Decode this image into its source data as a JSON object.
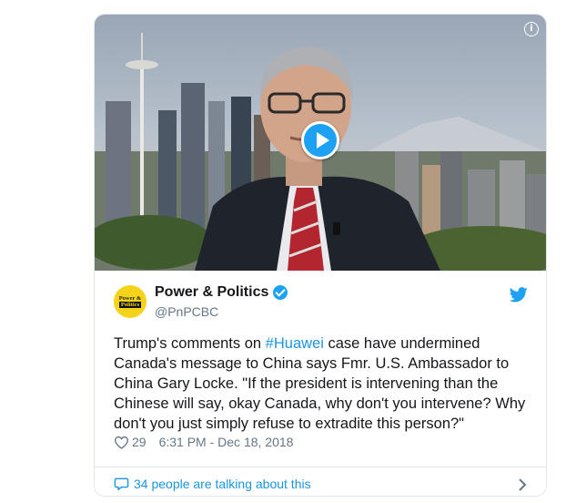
{
  "tweet": {
    "author_name": "Power & Politics",
    "handle": "@PnPCBC",
    "avatar_text": [
      "Power &",
      "Politics"
    ],
    "text_before": "Trump's comments on ",
    "hashtag": "#Huawei",
    "text_after": " case have undermined Canada's message to China says Fmr. U.S. Ambassador to China Gary Locke. \"If the president is intervening than the Chinese will say, okay Canada, why don't you intervene? Why don't you just simply refuse to extradite this person?\"",
    "likes": "29",
    "timestamp": "6:31 PM - Dec 18, 2018",
    "talking": "34 people are talking about this"
  },
  "media": {
    "info_icon": "i"
  },
  "colors": {
    "accent": "#1da1f2",
    "link": "#1b95e0",
    "muted": "#657786",
    "avatar_bg": "#f5d318"
  }
}
